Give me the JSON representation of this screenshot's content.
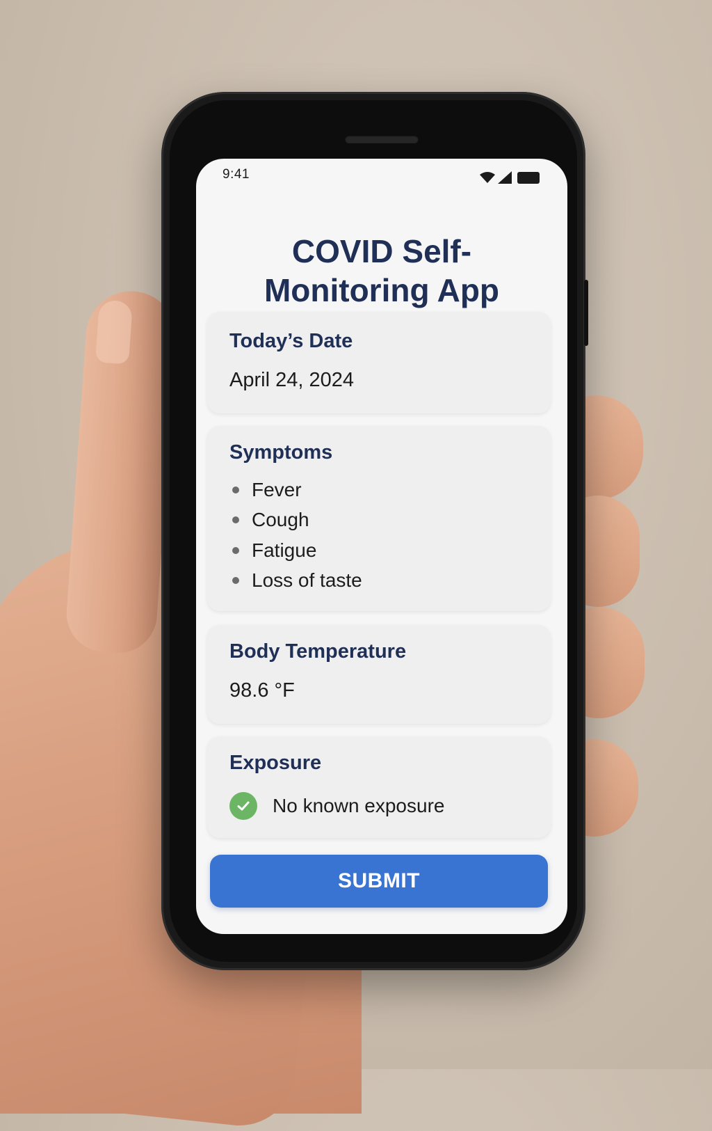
{
  "status_bar": {
    "time": "9:41",
    "icons": [
      "wifi-icon",
      "signal-icon",
      "battery-icon"
    ]
  },
  "app": {
    "title": "COVID Self-Monitoring App"
  },
  "date_card": {
    "title": "Today’s Date",
    "value": "April 24, 2024"
  },
  "symptoms_card": {
    "title": "Symptoms",
    "items": [
      "Fever",
      "Cough",
      "Fatigue",
      "Loss of taste"
    ]
  },
  "temperature_card": {
    "title": "Body Temperature",
    "value": "98.6 °F"
  },
  "exposure_card": {
    "title": "Exposure",
    "status_icon": "check-circle-icon",
    "status_text": "No known exposure"
  },
  "submit": {
    "label": "SUBMIT"
  },
  "colors": {
    "title": "#1f2f55",
    "accent": "#3a74d2",
    "success": "#6bb565",
    "background": "#f6f6f6"
  }
}
